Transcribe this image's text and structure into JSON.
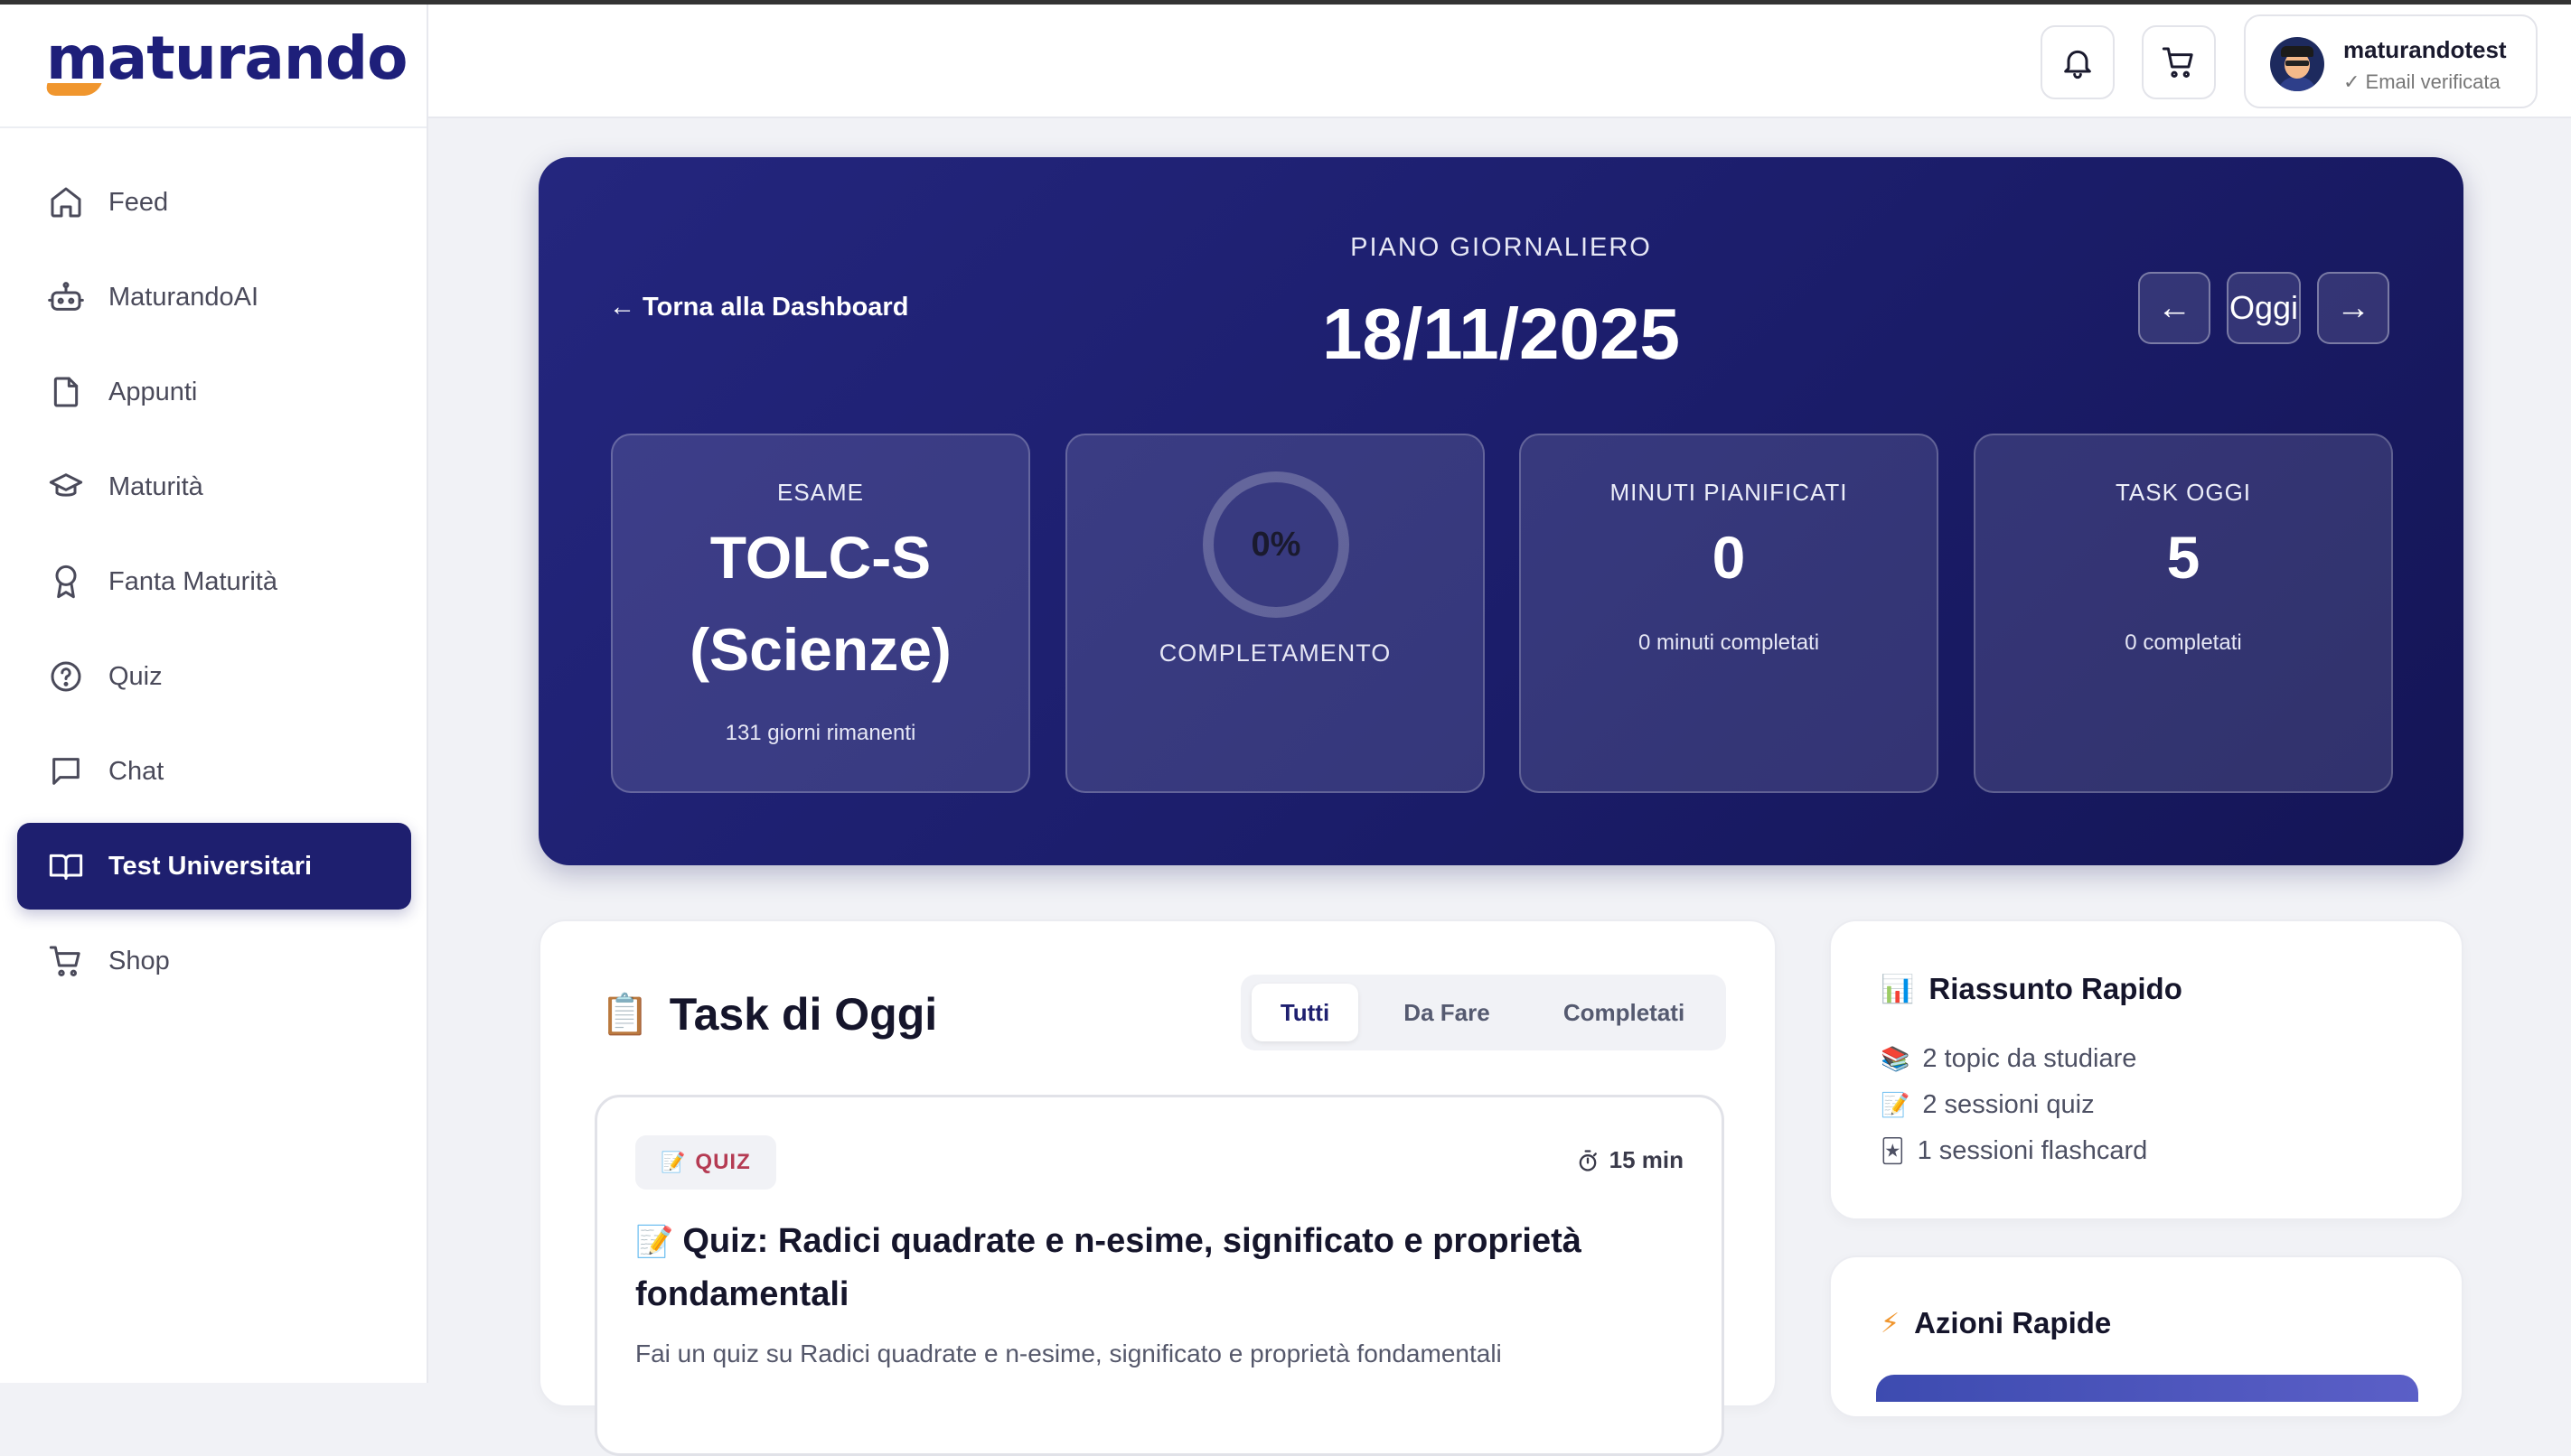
{
  "app": {
    "logo_text": "maturando",
    "accent_color": "#1e1f6f",
    "brand_orange": "#f0962e"
  },
  "sidebar": {
    "items": [
      {
        "label": "Feed",
        "icon": "home-icon"
      },
      {
        "label": "MaturandoAI",
        "icon": "robot-icon"
      },
      {
        "label": "Appunti",
        "icon": "document-icon"
      },
      {
        "label": "Maturità",
        "icon": "graduation-cap-icon"
      },
      {
        "label": "Fanta Maturità",
        "icon": "award-icon"
      },
      {
        "label": "Quiz",
        "icon": "question-circle-icon"
      },
      {
        "label": "Chat",
        "icon": "chat-bubble-icon"
      },
      {
        "label": "Test Universitari",
        "icon": "open-book-icon",
        "active": true
      },
      {
        "label": "Shop",
        "icon": "cart-icon"
      }
    ]
  },
  "header": {
    "notification_icon": "bell-icon",
    "cart_icon": "cart-icon",
    "user": {
      "name": "maturandotest",
      "status": "✓ Email verificata"
    }
  },
  "hero": {
    "back_link": "← Torna alla Dashboard",
    "label": "PIANO GIORNALIERO",
    "date": "18/11/2025",
    "prev_label": "←",
    "today_label": "Oggi",
    "next_label": "→",
    "stats": {
      "exam": {
        "label": "ESAME",
        "value_line1": "TOLC-S",
        "value_line2": "(Scienze)",
        "sub": "131 giorni rimanenti"
      },
      "completion": {
        "percent_text": "0%",
        "label": "COMPLETAMENTO",
        "progress": 0
      },
      "minutes": {
        "label": "MINUTI PIANIFICATI",
        "value": "0",
        "sub": "0 minuti completati"
      },
      "tasks": {
        "label": "TASK OGGI",
        "value": "5",
        "sub": "0 completati"
      }
    }
  },
  "tasks_panel": {
    "emoji": "📋",
    "title": "Task di Oggi",
    "filters": [
      "Tutti",
      "Da Fare",
      "Completati"
    ],
    "active_filter": "Tutti",
    "task": {
      "badge_emoji": "📝",
      "badge": "QUIZ",
      "duration": "15 min",
      "title_emoji": "📝",
      "title": "Quiz: Radici quadrate e n-esime, significato e proprietà fondamentali",
      "description": "Fai un quiz su Radici quadrate e n-esime, significato e proprietà fondamentali"
    }
  },
  "summary": {
    "emoji": "📊",
    "title": "Riassunto Rapido",
    "items": [
      {
        "emoji": "📚",
        "text": "2 topic da studiare"
      },
      {
        "emoji": "📝",
        "text": "2 sessioni quiz"
      },
      {
        "emoji": "🃏",
        "text": "1 sessioni flashcard"
      }
    ]
  },
  "actions": {
    "emoji": "⚡",
    "title": "Azioni Rapide"
  }
}
